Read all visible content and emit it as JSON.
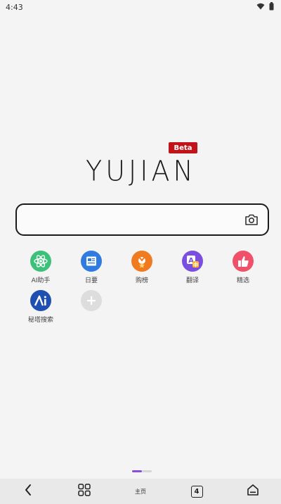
{
  "status_bar": {
    "time": "4:43",
    "wifi_icon": "wifi-icon",
    "battery_icon": "battery-icon"
  },
  "logo": {
    "text": "YUJIAN",
    "badge": "Beta",
    "badge_color": "#c0131a"
  },
  "search": {
    "value": "",
    "placeholder": "",
    "camera_icon": "camera-icon"
  },
  "shortcuts": [
    {
      "label": "AI助手",
      "icon": "atom-icon",
      "color": "#3cc07a"
    },
    {
      "label": "日要",
      "icon": "newspaper-icon",
      "color": "#2f7be0"
    },
    {
      "label": "购榜",
      "icon": "shopping-icon",
      "color": "#f07a20"
    },
    {
      "label": "翻译",
      "icon": "translate-icon",
      "color": "#7a4fe0"
    },
    {
      "label": "精选",
      "icon": "thumbs-up-icon",
      "color": "#f0506a"
    },
    {
      "label": "秘塔搜索",
      "icon": "metaso-icon",
      "color": "#1f4fb0"
    },
    {
      "label": "",
      "icon": "add-icon",
      "color": "#d9d9d9"
    }
  ],
  "page_indicator": {
    "pages": 2,
    "active": 1,
    "accent": "#8a4fd8"
  },
  "bottom_nav": {
    "back_icon": "back-icon",
    "menu_icon": "grid-menu-icon",
    "home_label": "主页",
    "tab_count": "4",
    "home_icon": "home-icon"
  }
}
